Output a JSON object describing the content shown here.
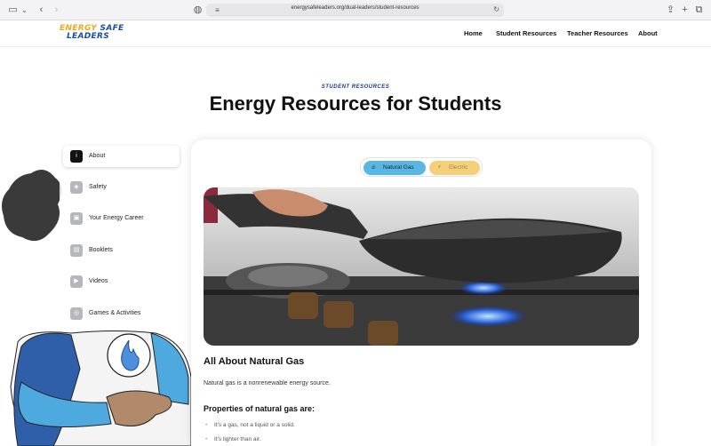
{
  "browser": {
    "url": "energysafeleaders.org/dual-leaders/student-resources"
  },
  "header": {
    "logo_line1_a": "ENERGY",
    "logo_line1_b": "SAFE",
    "logo_line2": "LEADERS",
    "nav": [
      "Home",
      "Student Resources",
      "Teacher Resources",
      "About"
    ]
  },
  "hero": {
    "eyebrow": "STUDENT RESOURCES",
    "title": "Energy Resources for Students"
  },
  "sidebar": {
    "items": [
      {
        "label": "About",
        "icon": "info-icon",
        "active": true
      },
      {
        "label": "Safety",
        "icon": "shield-icon",
        "active": false
      },
      {
        "label": "Your Energy Career",
        "icon": "briefcase-icon",
        "active": false
      },
      {
        "label": "Booklets",
        "icon": "book-icon",
        "active": false
      },
      {
        "label": "Videos",
        "icon": "play-icon",
        "active": false
      },
      {
        "label": "Games & Activities",
        "icon": "gamepad-icon",
        "active": false
      }
    ]
  },
  "toggle": {
    "gas_label": "Natural Gas",
    "electric_label": "Electric",
    "selected": "Natural Gas"
  },
  "content": {
    "section_title": "All About Natural Gas",
    "intro": "Natural gas is a nonrenewable energy source.",
    "properties_title": "Properties of natural gas are:",
    "properties": [
      "It's a gas, not a liquid or a solid.",
      "It's lighter than air."
    ]
  },
  "colors": {
    "gas_pill": "#5ab7e3",
    "electric_pill": "#f5d07a",
    "eyebrow": "#1a3a8a",
    "logo_orange": "#f0a81d",
    "logo_blue": "#1a4da3"
  }
}
